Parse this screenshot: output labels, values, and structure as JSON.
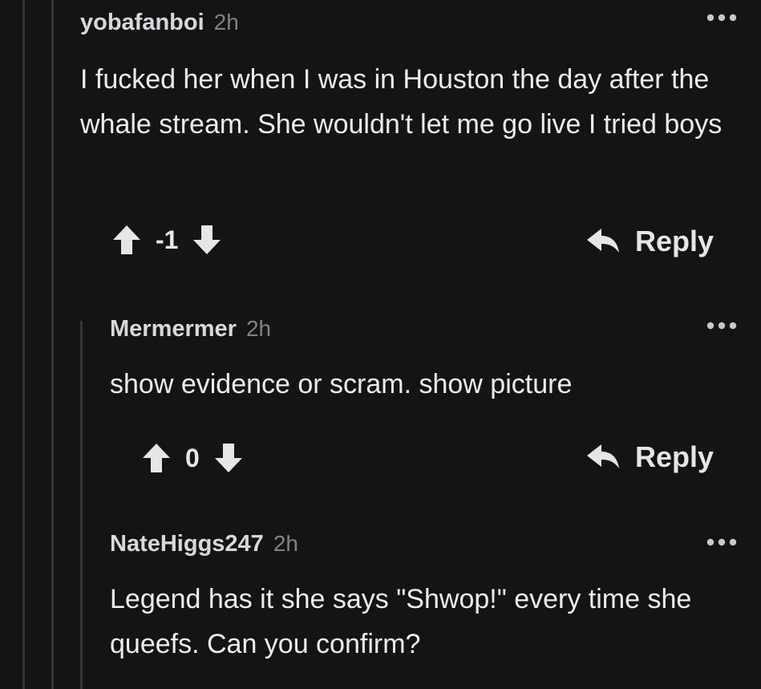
{
  "comments": [
    {
      "username": "yobafanboi",
      "time": "2h",
      "body": "I fucked her when I was in Houston the day after the whale stream. She wouldn't let me go live I tried boys",
      "score": "-1",
      "reply_label": "Reply",
      "more_icon": "more-horizontal-icon"
    },
    {
      "username": "Mermermer",
      "time": "2h",
      "body": "show evidence or scram. show picture",
      "score": "0",
      "reply_label": "Reply",
      "more_icon": "more-horizontal-icon"
    },
    {
      "username": "NateHiggs247",
      "time": "2h",
      "body": "Legend has it she says \"Shwop!\" every time she queefs. Can you confirm?",
      "more_icon": "more-horizontal-icon"
    }
  ],
  "icons": {
    "upvote": "arrow-up-icon",
    "downvote": "arrow-down-icon",
    "reply": "reply-arrow-icon"
  },
  "colors": {
    "background": "#141415",
    "thread_line": "#343437",
    "text": "#e6e6e6",
    "muted": "#818384"
  }
}
